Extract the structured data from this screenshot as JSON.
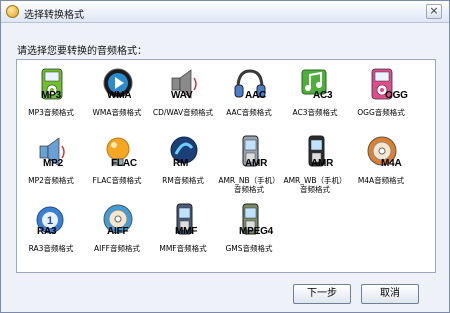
{
  "window": {
    "title": "选择转换格式",
    "close_glyph": "×"
  },
  "prompt": "请选择您要转换的音频格式：",
  "formats": [
    {
      "tag": "MP3",
      "label": "MP3音频格式",
      "icon": "mp3-player-icon",
      "color": "#6cc02a"
    },
    {
      "tag": "WMA",
      "label": "WMA音频格式",
      "icon": "wma-play-icon",
      "color": "#2a8ccf"
    },
    {
      "tag": "WAV",
      "label": "CD/WAV音频格式",
      "icon": "wav-speaker-icon",
      "color": "#8a8a8a"
    },
    {
      "tag": "AAC",
      "label": "AAC音频格式",
      "icon": "headphones-icon",
      "color": "#3a3a3a"
    },
    {
      "tag": "AC3",
      "label": "AC3音频格式",
      "icon": "music-note-icon",
      "color": "#4fae3c"
    },
    {
      "tag": "OGG",
      "label": "OGG音频格式",
      "icon": "ogg-player-icon",
      "color": "#e04b8c"
    },
    {
      "tag": "MP2",
      "label": "MP2音频格式",
      "icon": "mp2-speaker-icon",
      "color": "#6aa0d8"
    },
    {
      "tag": "FLAC",
      "label": "FLAC音频格式",
      "icon": "flac-bulb-icon",
      "color": "#f5a623"
    },
    {
      "tag": "RM",
      "label": "RM音频格式",
      "icon": "rm-logo-icon",
      "color": "#1f6fb8"
    },
    {
      "tag": "AMR",
      "label": "AMR_NB（手机）音频格式",
      "icon": "phone-nb-icon",
      "color": "#9aa2ad"
    },
    {
      "tag": "AMR",
      "label": "AMR_WB（手机）音频格式",
      "icon": "phone-wb-icon",
      "color": "#2b2b2b"
    },
    {
      "tag": "M4A",
      "label": "M4A音频格式",
      "icon": "m4a-disc-icon",
      "color": "#e0802a"
    },
    {
      "tag": "RA3",
      "label": "RA3音频格式",
      "icon": "ra3-circle-icon",
      "color": "#3a7fd0"
    },
    {
      "tag": "AIFF",
      "label": "AIFF音频格式",
      "icon": "aiff-disc-icon",
      "color": "#3c9fdc"
    },
    {
      "tag": "MMF",
      "label": "MMF音频格式",
      "icon": "mmf-phone-icon",
      "color": "#4a5a7a"
    },
    {
      "tag": "MPEG4",
      "label": "GMS音频格式",
      "icon": "mpeg4-phone-icon",
      "color": "#7a8a6a"
    }
  ],
  "buttons": {
    "next": "下一步",
    "cancel": "取消"
  }
}
